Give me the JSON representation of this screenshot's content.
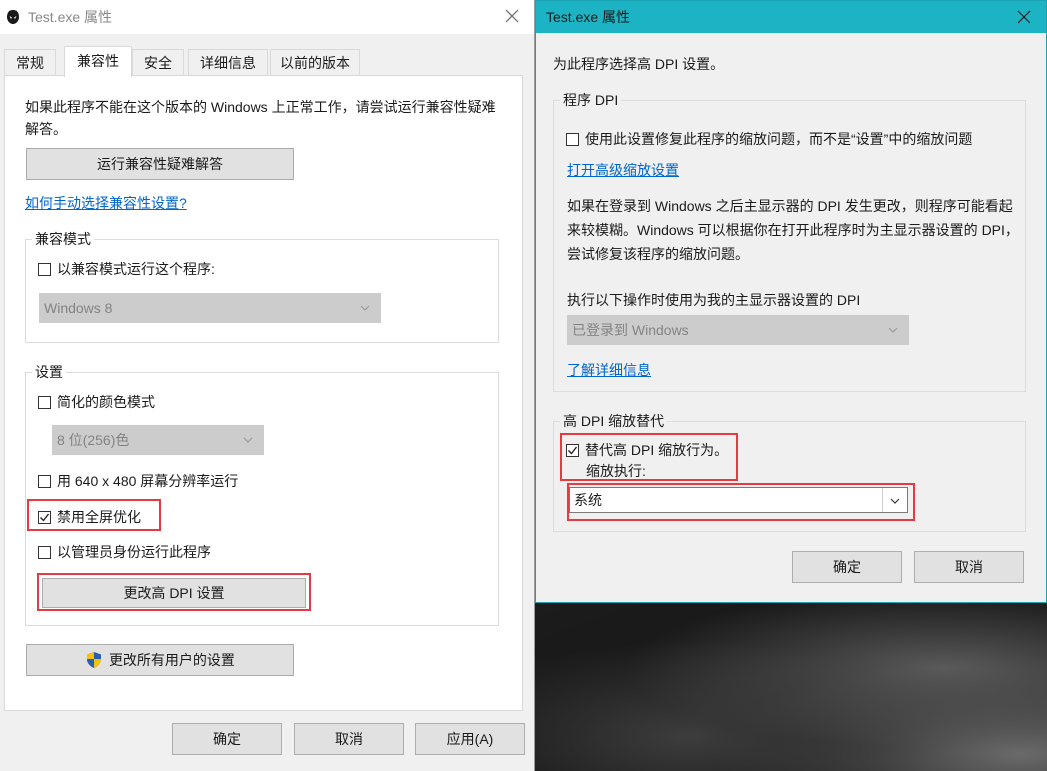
{
  "left_window": {
    "title": "Test.exe 属性",
    "tabs": [
      "常规",
      "兼容性",
      "安全",
      "详细信息",
      "以前的版本"
    ],
    "active_tab": "兼容性",
    "intro": "如果此程序不能在这个版本的 Windows 上正常工作，请尝试运行兼容性疑难解答。",
    "troubleshoot_button": "运行兼容性疑难解答",
    "manual_link": "如何手动选择兼容性设置?",
    "compat_mode": {
      "group_label": "兼容模式",
      "checkbox_label": "以兼容模式运行这个程序:",
      "checked": false,
      "select_value": "Windows 8"
    },
    "settings": {
      "group_label": "设置",
      "reduced_color": {
        "label": "简化的颜色模式",
        "checked": false
      },
      "color_select_value": "8 位(256)色",
      "res_640": {
        "label": "用 640 x 480 屏幕分辨率运行",
        "checked": false
      },
      "disable_fullscreen_opt": {
        "label": "禁用全屏优化",
        "checked": true
      },
      "run_as_admin": {
        "label": "以管理员身份运行此程序",
        "checked": false
      },
      "change_dpi_button": "更改高 DPI 设置"
    },
    "all_users_button": "更改所有用户的设置",
    "footer": {
      "ok": "确定",
      "cancel": "取消",
      "apply": "应用(A)"
    }
  },
  "right_window": {
    "title": "Test.exe 属性",
    "heading": "为此程序选择高 DPI 设置。",
    "program_dpi": {
      "group_label": "程序 DPI",
      "checkbox_label": "使用此设置修复此程序的缩放问题，而不是“设置”中的缩放问题",
      "checked": false,
      "advanced_link": "打开高级缩放设置",
      "description": "如果在登录到 Windows 之后主显示器的 DPI 发生更改，则程序可能看起来较模糊。Windows 可以根据你在打开此程序时为主显示器设置的 DPI，尝试修复该程序的缩放问题。",
      "select_label": "执行以下操作时使用为我的主显示器设置的 DPI",
      "select_value": "已登录到 Windows",
      "learn_more_link": "了解详细信息"
    },
    "high_dpi_override": {
      "group_label": "高 DPI 缩放替代",
      "checkbox_label": "替代高 DPI 缩放行为。",
      "checked": true,
      "sublabel": "缩放执行:",
      "select_value": "系统"
    },
    "footer": {
      "ok": "确定",
      "cancel": "取消"
    }
  },
  "colors": {
    "highlight_red": "#e53a40",
    "link_blue": "#0066cc",
    "right_titlebar": "#1cb4c4"
  }
}
